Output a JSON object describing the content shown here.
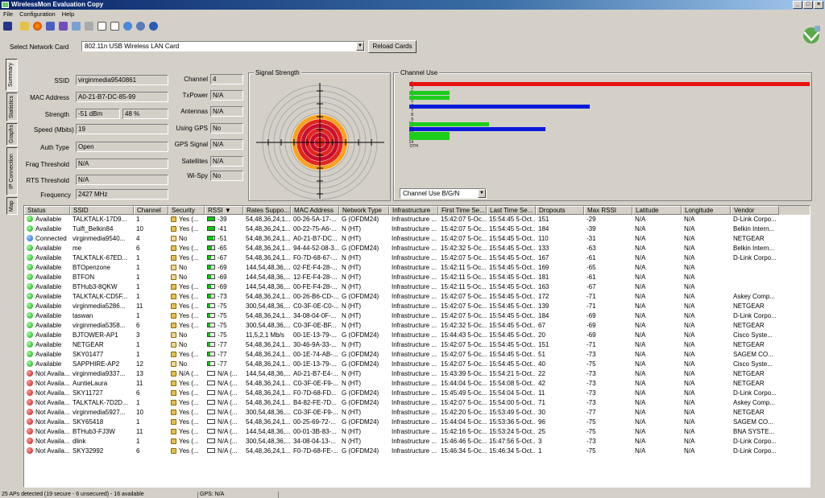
{
  "window": {
    "title": "WirelessMon Evaluation Copy"
  },
  "menu": [
    "File",
    "Configuration",
    "Help"
  ],
  "toolbar": [
    "save-icon",
    "open-icon",
    "globe-icon",
    "network-icon",
    "network2-icon",
    "export-icon",
    "print-icon",
    "check-icon",
    "document-icon",
    "web-icon",
    "about-icon",
    "help-icon"
  ],
  "card": {
    "label": "Select Network Card",
    "value": "802.11n USB Wireless LAN Card",
    "reload": "Reload Cards"
  },
  "tabs": [
    "Summary",
    "Statistics",
    "Graphs",
    "IP Connection",
    "Map"
  ],
  "summary": {
    "ssid_label": "SSID",
    "ssid": "virginmedia9540861",
    "mac_label": "MAC Address",
    "mac": "A0-21-B7-DC-85-99",
    "strength_label": "Strength",
    "strength_dbm": "-51 dBm",
    "strength_pct": "48 %",
    "speed_label": "Speed (Mbits)",
    "speed": "19",
    "auth_label": "Auth Type",
    "auth": "Open",
    "frag_label": "Frag Threshold",
    "frag": "N/A",
    "rts_label": "RTS Threshold",
    "rts": "N/A",
    "freq_label": "Frequency",
    "freq": "2427 MHz",
    "channel_label": "Channel",
    "channel": "4",
    "txpower_label": "TxPower",
    "txpower": "N/A",
    "antennas_label": "Antennas",
    "antennas": "N/A",
    "gps_label": "Using GPS",
    "gps": "No",
    "gpssig_label": "GPS Signal",
    "gpssig": "N/A",
    "sat_label": "Satellites",
    "sat": "N/A",
    "wispy_label": "Wi-Spy",
    "wispy": "No"
  },
  "signal": {
    "title": "Signal Strength",
    "level_pct": 48
  },
  "channel_use": {
    "title": "Channel Use",
    "mode": "Channel Use B/G/N",
    "labels": [
      "1",
      "2",
      "3",
      "4",
      "5",
      "6",
      "7",
      "8",
      "9",
      "10",
      "11",
      "12",
      "13",
      "14",
      "OTH"
    ],
    "bars": [
      {
        "ch": "1",
        "value": 1.0,
        "color": "#e81010"
      },
      {
        "ch": "3",
        "value": 0.1,
        "color": "#1ccd1c"
      },
      {
        "ch": "4",
        "value": 0.1,
        "color": "#1ccd1c"
      },
      {
        "ch": "6",
        "value": 0.45,
        "color": "#0a1ad8"
      },
      {
        "ch": "10",
        "value": 0.2,
        "color": "#1ccd1c"
      },
      {
        "ch": "11",
        "value": 0.34,
        "color": "#0a1ad8"
      },
      {
        "ch": "12",
        "value": 0.1,
        "color": "#1ccd1c"
      },
      {
        "ch": "13",
        "value": 0.1,
        "color": "#1ccd1c"
      }
    ]
  },
  "table": {
    "columns": [
      "Status",
      "SSID",
      "Channel",
      "Security",
      "RSSI",
      "Rates Suppo...",
      "MAC Address",
      "Network Type",
      "Infrastructure",
      "First Time Se...",
      "Last Time Se...",
      "Dropouts",
      "Max RSSI",
      "Latitude",
      "Longitude",
      "Vendor"
    ],
    "rows": [
      [
        "Available",
        "TALKTALK-17D9...",
        "1",
        "Yes (...",
        "-39",
        "54,48,36,24,1...",
        "00-26-5A-17-...",
        "G (OFDM24)",
        "Infrastructure ...",
        "15:42:07 5-Oc...",
        "15:54:45 5-Oct...",
        "151",
        "-29",
        "N/A",
        "N/A",
        "D-Link Corpo..."
      ],
      [
        "Available",
        "Tuift_Belkin84",
        "10",
        "Yes (...",
        "-41",
        "54,48,36,24,1...",
        "00-22-75-A6-...",
        "N (HT)",
        "Infrastructure ...",
        "15:42:07 5-Oc...",
        "15:54:45 5-Oct...",
        "184",
        "-39",
        "N/A",
        "N/A",
        "Belkin Intern..."
      ],
      [
        "Connected",
        "virginmedia9540...",
        "4",
        "No",
        "-51",
        "54,48,36,24,1...",
        "A0-21-B7-DC...",
        "N (HT)",
        "Infrastructure ...",
        "15:42:07 5-Oc...",
        "15:54:45 5-Oct...",
        "110",
        "-31",
        "N/A",
        "N/A",
        "NETGEAR"
      ],
      [
        "Available",
        "me",
        "6",
        "Yes (...",
        "-65",
        "54,48,36,24,1...",
        "94-44-52-08-3...",
        "G (OFDM24)",
        "Infrastructure ...",
        "15:42:32 5-Oc...",
        "15:54:45 5-Oct...",
        "133",
        "-63",
        "N/A",
        "N/A",
        "Belkin Intern..."
      ],
      [
        "Available",
        "TALKTALK-67ED...",
        "1",
        "Yes (...",
        "-67",
        "54,48,36,24,1...",
        "F0-7D-68-67-...",
        "N (HT)",
        "Infrastructure ...",
        "15:42:07 5-Oc...",
        "15:54:45 5-Oct...",
        "167",
        "-61",
        "N/A",
        "N/A",
        "D-Link Corpo..."
      ],
      [
        "Available",
        "BTOpenzone",
        "1",
        "No",
        "-69",
        "144,54,48,36,...",
        "02-FE-F4-28-...",
        "N (HT)",
        "Infrastructure ...",
        "15:42:11 5-Oc...",
        "15:54:45 5-Oct...",
        "169",
        "-65",
        "N/A",
        "N/A",
        ""
      ],
      [
        "Available",
        "BTFON",
        "1",
        "No",
        "-69",
        "144,54,48,36,...",
        "12-FE-F4-28-...",
        "N (HT)",
        "Infrastructure ...",
        "15:42:11 5-Oc...",
        "15:54:45 5-Oct...",
        "181",
        "-61",
        "N/A",
        "N/A",
        ""
      ],
      [
        "Available",
        "BTHub3-8QKW",
        "1",
        "Yes (...",
        "-69",
        "144,54,48,36,...",
        "00-FE-F4-28-...",
        "N (HT)",
        "Infrastructure ...",
        "15:42:11 5-Oc...",
        "15:54:45 5-Oct...",
        "163",
        "-67",
        "N/A",
        "N/A",
        ""
      ],
      [
        "Available",
        "TALKTALK-CD5F...",
        "1",
        "Yes (...",
        "-73",
        "54,48,36,24,1...",
        "00-26-B6-CD-...",
        "G (OFDM24)",
        "Infrastructure ...",
        "15:42:07 5-Oc...",
        "15:54:45 5-Oct...",
        "172",
        "-71",
        "N/A",
        "N/A",
        "Askey Comp..."
      ],
      [
        "Available",
        "virginmedia5286...",
        "11",
        "Yes (...",
        "-75",
        "300,54,48,36,...",
        "C0-3F-0E-C0-...",
        "N (HT)",
        "Infrastructure ...",
        "15:42:07 5-Oc...",
        "15:54:45 5-Oct...",
        "139",
        "-71",
        "N/A",
        "N/A",
        "NETGEAR"
      ],
      [
        "Available",
        "taswan",
        "1",
        "Yes (...",
        "-75",
        "54,48,36,24,1...",
        "34-08-04-0F-...",
        "N (HT)",
        "Infrastructure ...",
        "15:42:07 5-Oc...",
        "15:54:45 5-Oct...",
        "184",
        "-69",
        "N/A",
        "N/A",
        "D-Link Corpo..."
      ],
      [
        "Available",
        "virginmedia5358...",
        "6",
        "Yes (...",
        "-75",
        "300,54,48,36,...",
        "C0-3F-0E-BF...",
        "N (HT)",
        "Infrastructure ...",
        "15:42:32 5-Oc...",
        "15:54:45 5-Oct...",
        "67",
        "-69",
        "N/A",
        "N/A",
        "NETGEAR"
      ],
      [
        "Available",
        "BJTOWER-AP1",
        "3",
        "No",
        "-75",
        "11,5,2,1 Mb/s",
        "00-1E-13-79-...",
        "G (OFDM24)",
        "Infrastructure ...",
        "15:44:43 5-Oc...",
        "15:54:45 5-Oct...",
        "20",
        "-69",
        "N/A",
        "N/A",
        "Cisco Syste..."
      ],
      [
        "Available",
        "NETGEAR",
        "1",
        "No",
        "-77",
        "54,48,36,24,1...",
        "30-46-9A-33-...",
        "N (HT)",
        "Infrastructure ...",
        "15:42:07 5-Oc...",
        "15:54:45 5-Oct...",
        "151",
        "-71",
        "N/A",
        "N/A",
        "NETGEAR"
      ],
      [
        "Available",
        "SKY01477",
        "1",
        "Yes (...",
        "-77",
        "54,48,36,24,1...",
        "00-1E-74-AB-...",
        "G (OFDM24)",
        "Infrastructure ...",
        "15:42:07 5-Oc...",
        "15:54:45 5-Oct...",
        "51",
        "-73",
        "N/A",
        "N/A",
        "SAGEM CO..."
      ],
      [
        "Available",
        "SAPPHIRE-AP2",
        "12",
        "No",
        "-77",
        "54,48,36,24,1...",
        "00-1E-13-79-...",
        "G (OFDM24)",
        "Infrastructure ...",
        "15:42:07 5-Oc...",
        "15:54:45 5-Oct...",
        "40",
        "-75",
        "N/A",
        "N/A",
        "Cisco Syste..."
      ],
      [
        "Not Availa...",
        "virginmedia9337...",
        "13",
        "N/A (...",
        "N/A (...",
        "144,54,48,36,...",
        "A0-21-B7-E4-...",
        "N (HT)",
        "Infrastructure ...",
        "15:43:39 5-Oc...",
        "15:54:21 5-Oct...",
        "22",
        "-73",
        "N/A",
        "N/A",
        "NETGEAR"
      ],
      [
        "Not Availa...",
        "AuntieLaura",
        "11",
        "Yes (...",
        "N/A (...",
        "54,48,36,24,1...",
        "C0-3F-0E-F9-...",
        "N (HT)",
        "Infrastructure ...",
        "15:44:04 5-Oc...",
        "15:54:08 5-Oct...",
        "42",
        "-73",
        "N/A",
        "N/A",
        "NETGEAR"
      ],
      [
        "Not Availa...",
        "SKY11727",
        "6",
        "Yes (...",
        "N/A (...",
        "54,48,36,24,1...",
        "F0-7D-68-FD...",
        "G (OFDM24)",
        "Infrastructure ...",
        "15:45:49 5-Oc...",
        "15:54:04 5-Oct...",
        "11",
        "-73",
        "N/A",
        "N/A",
        "D-Link Corpo..."
      ],
      [
        "Not Availa...",
        "TALKTALK-7D2D...",
        "1",
        "Yes (...",
        "N/A (...",
        "54,48,36,24,1...",
        "B4-82-FE-7D...",
        "G (OFDM24)",
        "Infrastructure ...",
        "15:42:07 5-Oc...",
        "15:54:00 5-Oct...",
        "71",
        "-73",
        "N/A",
        "N/A",
        "Askey Comp..."
      ],
      [
        "Not Availa...",
        "virginmedia5927...",
        "10",
        "Yes (...",
        "N/A (...",
        "300,54,48,36,...",
        "C0-3F-0E-F9-...",
        "N (HT)",
        "Infrastructure ...",
        "15:42:20 5-Oc...",
        "15:53:49 5-Oct...",
        "30",
        "-77",
        "N/A",
        "N/A",
        "NETGEAR"
      ],
      [
        "Not Availa...",
        "SKY65418",
        "1",
        "Yes (...",
        "N/A (...",
        "54,48,36,24,1...",
        "00-25-69-72-...",
        "G (OFDM24)",
        "Infrastructure ...",
        "15:44:04 5-Oc...",
        "15:53:36 5-Oct...",
        "96",
        "-75",
        "N/A",
        "N/A",
        "SAGEM CO..."
      ],
      [
        "Not Availa...",
        "BTHub3-FJ3W",
        "11",
        "Yes (...",
        "N/A (...",
        "144,54,48,36,...",
        "00-01-3B-83-...",
        "N (HT)",
        "Infrastructure ...",
        "15:42:16 5-Oc...",
        "15:53:24 5-Oct...",
        "25",
        "-75",
        "N/A",
        "N/A",
        "BNA SYSTE..."
      ],
      [
        "Not Availa...",
        "dlink",
        "1",
        "Yes (...",
        "N/A (...",
        "300,54,48,36,...",
        "34-08-04-13-...",
        "N (HT)",
        "Infrastructure ...",
        "15:46:46 5-Oc...",
        "15:47:56 5-Oct...",
        "3",
        "-73",
        "N/A",
        "N/A",
        "D-Link Corpo..."
      ],
      [
        "Not Availa...",
        "SKY32992",
        "6",
        "Yes (...",
        "N/A (...",
        "54,48,36,24,1...",
        "F0-7D-68-FE-...",
        "G (OFDM24)",
        "Infrastructure ...",
        "15:46:34 5-Oc...",
        "15:46:34 5-Oct...",
        "1",
        "-75",
        "N/A",
        "N/A",
        "D-Link Corpo..."
      ]
    ]
  },
  "status": {
    "left": "25 APs detected (19 secure - 6 unsecured) - 16 available",
    "gps": "GPS: N/A"
  }
}
